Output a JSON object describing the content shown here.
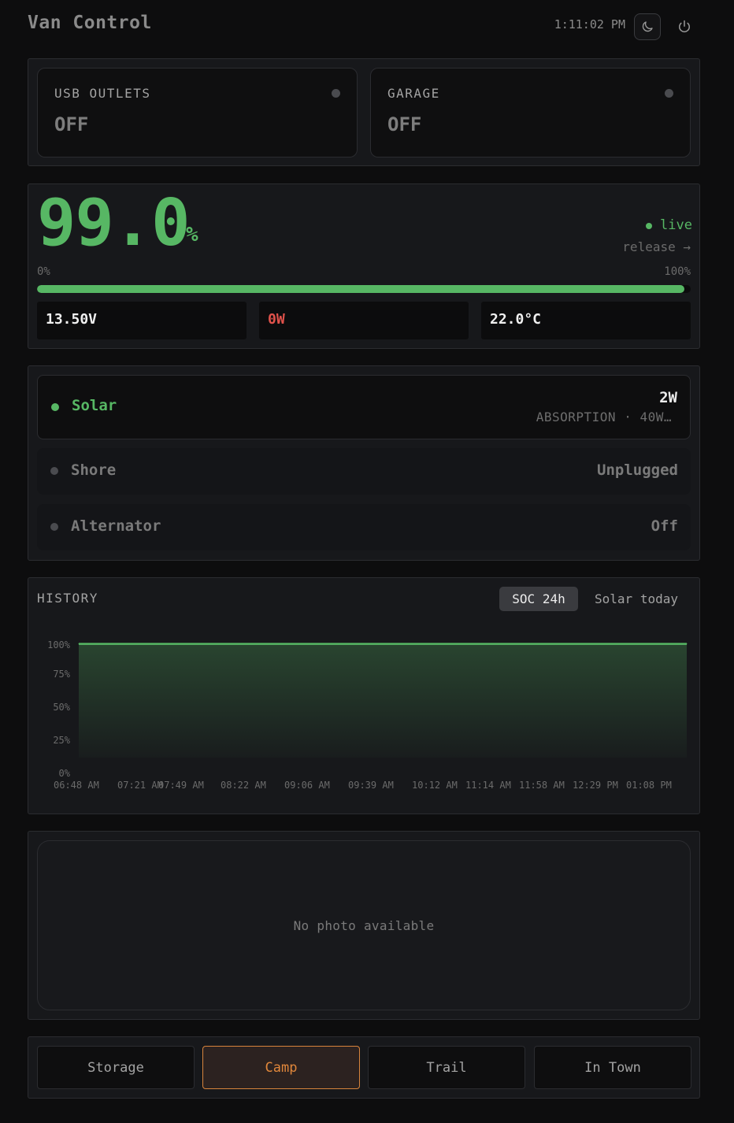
{
  "header": {
    "title": "Van Control",
    "clock": "1:11:02 PM"
  },
  "outlets": [
    {
      "label": "USB OUTLETS",
      "state": "OFF"
    },
    {
      "label": "GARAGE",
      "state": "OFF"
    }
  ],
  "battery": {
    "soc": "99.0",
    "soc_unit": "%",
    "soc_fraction": 0.99,
    "live_label": "live",
    "release_label": "release →",
    "scale_min": "0%",
    "scale_max": "100%",
    "voltage": "13.50V",
    "power": "0W",
    "temperature": "22.0°C",
    "colors": {
      "good": "#57b764",
      "power": "#e0524b"
    }
  },
  "sources": {
    "solar": {
      "name": "Solar",
      "value": "2W",
      "sub": "ABSORPTION · 40W…",
      "active": true
    },
    "shore": {
      "name": "Shore",
      "value": "Unplugged",
      "active": false
    },
    "alternator": {
      "name": "Alternator",
      "value": "Off",
      "active": false
    }
  },
  "history": {
    "title": "HISTORY",
    "tabs": [
      "SOC 24h",
      "Solar today"
    ],
    "active_tab": "SOC 24h"
  },
  "chart_data": {
    "type": "area",
    "x": [
      "06:48 AM",
      "07:21 AM",
      "07:49 AM",
      "08:22 AM",
      "09:06 AM",
      "09:39 AM",
      "10:12 AM",
      "11:14 AM",
      "11:58 AM",
      "12:29 PM",
      "01:08 PM"
    ],
    "series": [
      {
        "values": [
          99,
          99,
          99,
          99,
          99,
          99,
          99,
          99,
          99,
          99,
          99
        ]
      }
    ],
    "y_ticks": [
      "100%",
      "75%",
      "50%",
      "25%",
      "0%"
    ],
    "ylim": [
      0,
      100
    ],
    "grid": false,
    "color": "#57b764"
  },
  "photo": {
    "empty_text": "No photo available"
  },
  "modes": {
    "items": [
      "Storage",
      "Camp",
      "Trail",
      "In Town"
    ],
    "active": "Camp"
  }
}
